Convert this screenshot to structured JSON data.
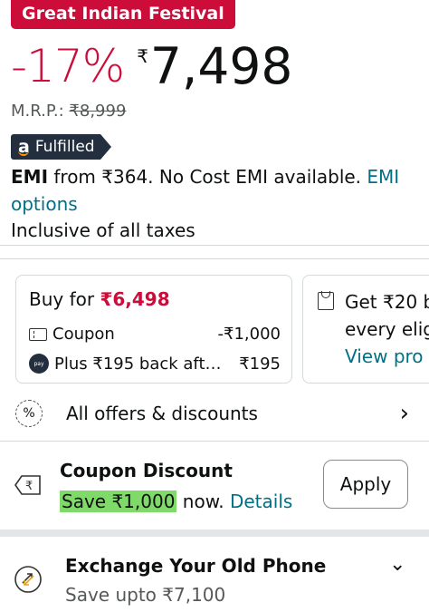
{
  "badge": "Great Indian Festival",
  "price": {
    "discount": "-17%",
    "currency": "₹",
    "amount": "7,498",
    "mrp_label": "M.R.P.:",
    "mrp_value": "₹8,999"
  },
  "fulfilled_label": "Fulfilled",
  "emi": {
    "bold": "EMI",
    "text": " from ₹364. No Cost EMI available. ",
    "link": "EMI options"
  },
  "taxes": "Inclusive of all taxes",
  "offer_card_1": {
    "buy_for_label": "Buy for ",
    "buy_for_price": "₹6,498",
    "rows": [
      {
        "icon": "coupon-icon",
        "label": "Coupon",
        "amount": "-₹1,000"
      },
      {
        "icon": "amazon-pay-icon",
        "label": "Plus ₹195 back aft…",
        "amount": "₹195"
      }
    ]
  },
  "offer_card_2": {
    "line1": "Get ₹20 b",
    "line2": "every elig",
    "link": "View pro"
  },
  "offers_row": {
    "label": "All offers & discounts"
  },
  "coupon": {
    "title": "Coupon Discount",
    "highlight": "Save ₹1,000",
    "rest": " now. ",
    "link": "Details",
    "button": "Apply"
  },
  "exchange": {
    "title": "Exchange Your Old Phone",
    "subtitle": "Save upto ₹7,100"
  },
  "colors": {
    "deal_red": "#cc0c39",
    "link_teal": "#007185",
    "highlight_green": "#7fda69",
    "amazon_navy": "#232f3e"
  }
}
